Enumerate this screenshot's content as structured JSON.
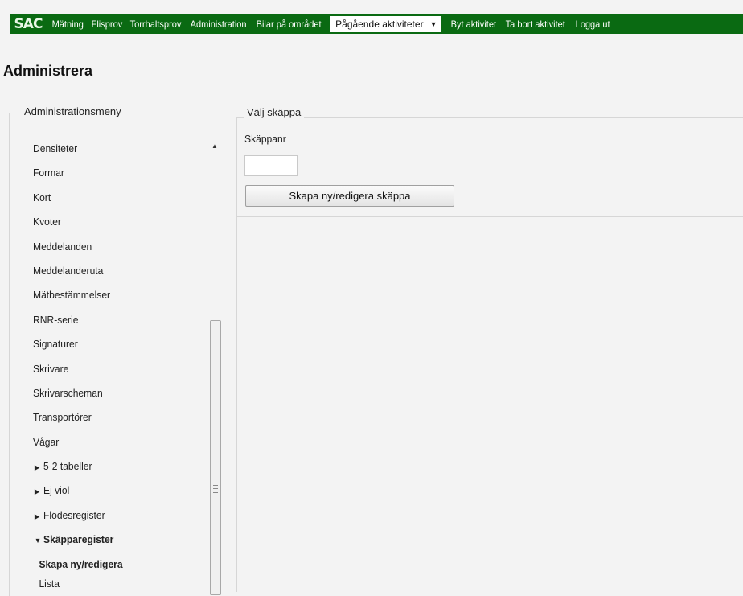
{
  "nav": {
    "logo": "SAC",
    "items": [
      "Mätning",
      "Flisprov",
      "Torrhaltsprov",
      "Administration",
      "Bilar på området"
    ],
    "activity_select": "Pågående aktiviteter",
    "actions": [
      "Byt aktivitet",
      "Ta bort aktivitet",
      "Logga ut"
    ]
  },
  "page_title": "Administrera",
  "menu": {
    "legend": "Administrationsmeny",
    "items": [
      "Densiteter",
      "Formar",
      "Kort",
      "Kvoter",
      "Meddelanden",
      "Meddelanderuta",
      "Mätbestämmelser",
      "RNR-serie",
      "Signaturer",
      "Skrivare",
      "Skrivarscheman",
      "Transportörer",
      "Vågar"
    ],
    "groups": [
      "5-2 tabeller",
      "Ej viol",
      "Flödesregister"
    ],
    "expanded_group": "Skäpparegister",
    "sub_items": [
      "Skapa ny/redigera",
      "Lista"
    ]
  },
  "select_box": {
    "legend": "Välj skäppa",
    "field_label": "Skäppanr",
    "field_value": "",
    "button_label": "Skapa ny/redigera skäppa"
  }
}
